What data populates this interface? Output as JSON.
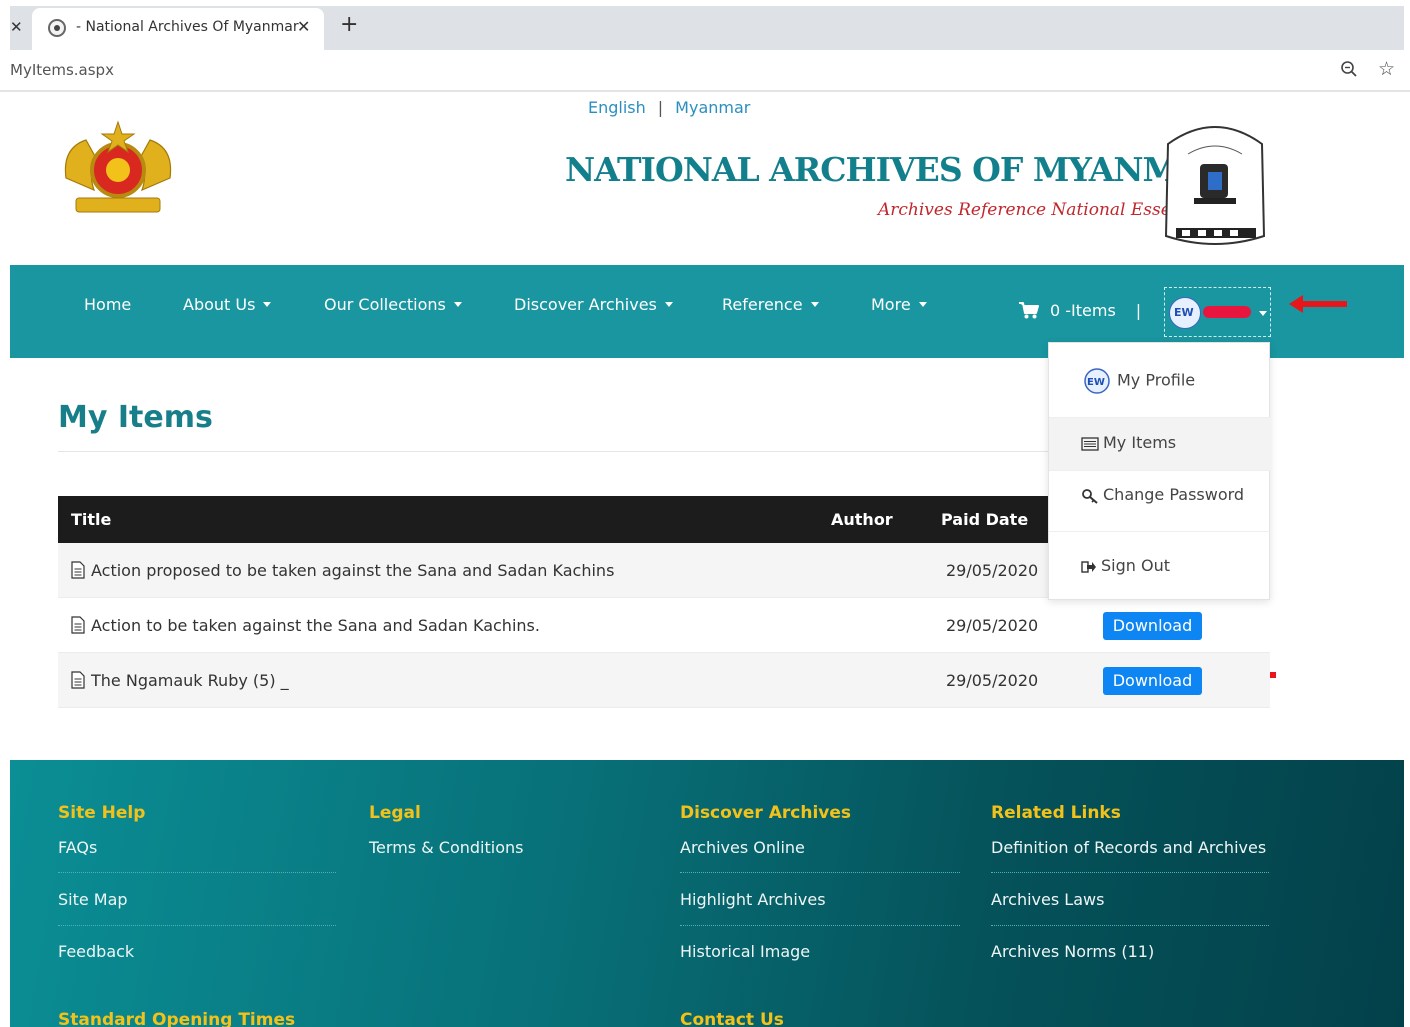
{
  "browser": {
    "tab_title": "- National Archives Of Myanmar",
    "url": "MyItems.aspx"
  },
  "header": {
    "lang_english": "English",
    "lang_separator": "|",
    "lang_myanmar": "Myanmar",
    "site_title": "NATIONAL ARCHIVES OF MYANMAR",
    "tagline": "Archives Reference National Essence"
  },
  "nav": {
    "items": [
      "Home",
      "About Us",
      "Our Collections",
      "Discover Archives",
      "Reference",
      "More"
    ],
    "cart_label": "0 -Items",
    "cart_separator": "|"
  },
  "user_menu": {
    "items": [
      "My Profile",
      "My Items",
      "Change Password",
      "Sign Out"
    ]
  },
  "main": {
    "page_title": "My Items",
    "table": {
      "columns": [
        "Title",
        "Author",
        "Paid Date"
      ],
      "rows": [
        {
          "title": "Action proposed to be taken against the Sana and Sadan Kachins",
          "author": "",
          "paid_date": "29/05/2020",
          "download": ""
        },
        {
          "title": "Action to be taken against the Sana and Sadan Kachins.",
          "author": "",
          "paid_date": "29/05/2020",
          "download": "Download"
        },
        {
          "title": "The Ngamauk Ruby (5) _",
          "author": "",
          "paid_date": "29/05/2020",
          "download": "Download"
        }
      ]
    }
  },
  "footer": {
    "site_help": {
      "heading": "Site Help",
      "links": [
        "FAQs",
        "Site Map",
        "Feedback"
      ]
    },
    "legal": {
      "heading": "Legal",
      "links": [
        "Terms & Conditions"
      ]
    },
    "discover": {
      "heading": "Discover Archives",
      "links": [
        "Archives Online",
        "Highlight Archives",
        "Historical Image"
      ]
    },
    "related": {
      "heading": "Related Links",
      "links": [
        "Definition of Records and Archives",
        "Archives Laws",
        "Archives Norms (11)"
      ]
    },
    "opening_times_heading": "Standard Opening Times",
    "contact_heading": "Contact Us"
  },
  "colors": {
    "nav_bg": "#1a96a0",
    "title_teal": "#127f8c",
    "footer_heading": "#f2c21a",
    "download_blue": "#0d86f3",
    "annotation_red": "#e8161b"
  }
}
